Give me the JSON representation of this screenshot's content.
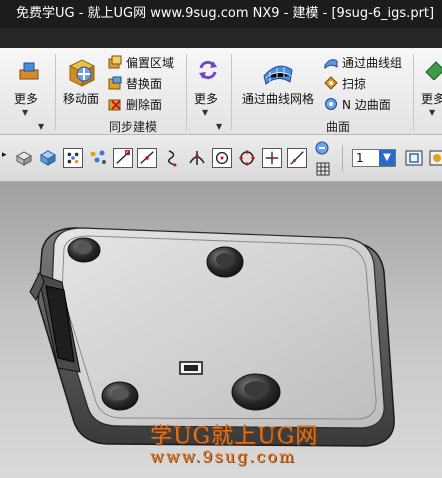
{
  "window": {
    "title": "免费学UG - 就上UG网 www.9sug.com NX9 - 建模 - [9sug-6_igs.prt]"
  },
  "ribbon": {
    "more_left": "更多",
    "move_face": "移动面",
    "offset_region": "偏置区域",
    "replace_face": "替换面",
    "delete_face": "删除面",
    "sync_modeling_group": "同步建模",
    "more_mid": "更多",
    "through_curve_mesh": "通过曲线网格",
    "through_curves": "通过曲线组",
    "swept": "扫掠",
    "n_sided_surface": "N 边曲面",
    "surface_group": "曲面",
    "more_right": "更多"
  },
  "toolbar": {
    "layer_value": "1"
  },
  "viewport": {
    "watermark_line1": "学UG就上UG网",
    "watermark_line2": "www.9sug.com"
  },
  "colors": {
    "title_bg": "#1c1c1c",
    "watermark": "#e2731c"
  }
}
